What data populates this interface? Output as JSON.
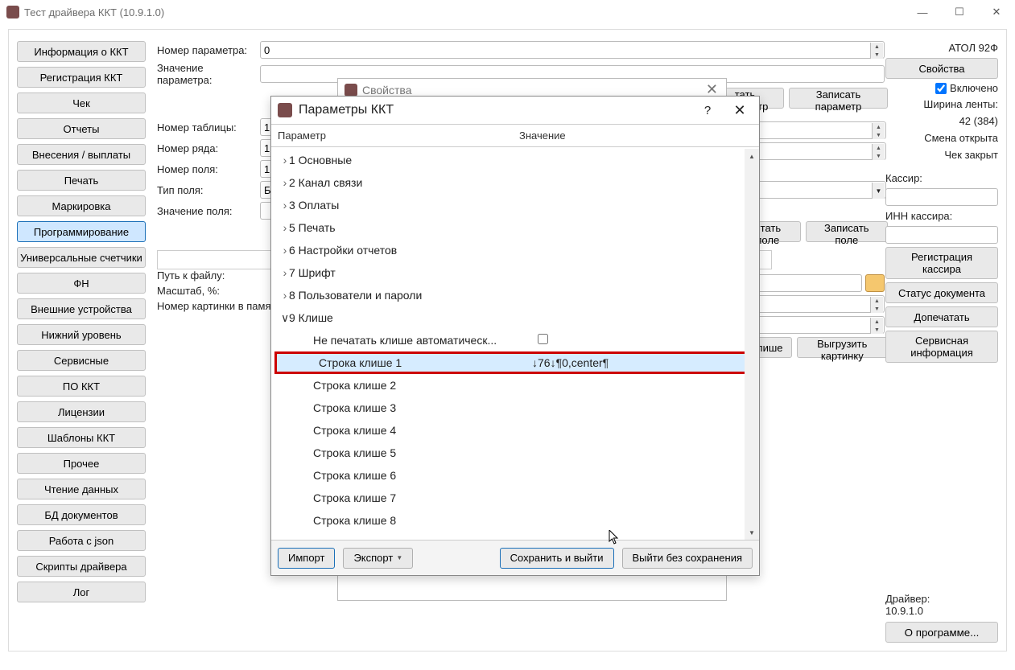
{
  "window": {
    "title": "Тест драйвера ККТ (10.9.1.0)"
  },
  "sidebar": {
    "items": [
      "Информация о ККТ",
      "Регистрация ККТ",
      "Чек",
      "Отчеты",
      "Внесения / выплаты",
      "Печать",
      "Маркировка",
      "Программирование",
      "Универсальные счетчики",
      "ФН",
      "Внешние устройства",
      "Нижний уровень",
      "Сервисные",
      "ПО ККТ",
      "Лицензии",
      "Шаблоны ККТ",
      "Прочее",
      "Чтение данных",
      "БД документов",
      "Работа с json",
      "Скрипты драйвера",
      "Лог"
    ],
    "active_index": 7
  },
  "center": {
    "labels": {
      "param_num": "Номер параметра:",
      "param_val": "Значение параметра:",
      "table_num": "Номер таблицы:",
      "row_num": "Номер ряда:",
      "field_num": "Номер поля:",
      "field_type": "Тип поля:",
      "field_val": "Значение поля:",
      "file_path": "Путь к файлу:",
      "scale": "Масштаб, %:",
      "pic_num": "Номер картинки в памят"
    },
    "values": {
      "param_num": "0",
      "table_num": "1",
      "row_num": "1",
      "field_num": "1",
      "field_type": "Байт"
    },
    "buttons": {
      "read_param": "тать параметр",
      "write_param": "Записать параметр",
      "read_field": "итать поле",
      "write_field": "Записать поле",
      "klishe": "лише",
      "upload_pic": "Выгрузить картинку"
    }
  },
  "right": {
    "device": "АТОЛ 92Ф",
    "props_btn": "Свойства",
    "enabled_label": "Включено",
    "tape_width_label": "Ширина ленты:",
    "tape_width_value": "42 (384)",
    "shift_open": "Смена открыта",
    "check_closed": "Чек закрыт",
    "cashier_label": "Кассир:",
    "inn_label": "ИНН кассира:",
    "reg_cashier": "Регистрация\nкассира",
    "doc_status": "Статус документа",
    "reprint": "Допечатать",
    "service_info": "Сервисная\nинформация",
    "driver_label": "Драйвер:",
    "driver_ver": "10.9.1.0",
    "about": "О программе..."
  },
  "props_dialog": {
    "title": "Свойства"
  },
  "modal": {
    "title": "Параметры ККТ",
    "col_param": "Параметр",
    "col_val": "Значение",
    "groups": [
      "1 Основные",
      "2 Канал связи",
      "3 Оплаты",
      "5 Печать",
      "6 Настройки отчетов",
      "7 Шрифт",
      "8 Пользователи и пароли",
      "9 Клише"
    ],
    "klishe_items": [
      {
        "label": "Не печатать клише автоматическ...",
        "value_type": "check"
      },
      {
        "label": "Строка клише 1",
        "value": "↓76↓¶0,center¶",
        "selected": true
      },
      {
        "label": "Строка клише 2"
      },
      {
        "label": "Строка клише 3"
      },
      {
        "label": "Строка клише 4"
      },
      {
        "label": "Строка клише 5"
      },
      {
        "label": "Строка клише 6"
      },
      {
        "label": "Строка клише 7"
      },
      {
        "label": "Строка клише 8"
      }
    ],
    "footer": {
      "import": "Импорт",
      "export": "Экспорт",
      "save_exit": "Сохранить и выйти",
      "exit_nosave": "Выйти без сохранения"
    }
  }
}
